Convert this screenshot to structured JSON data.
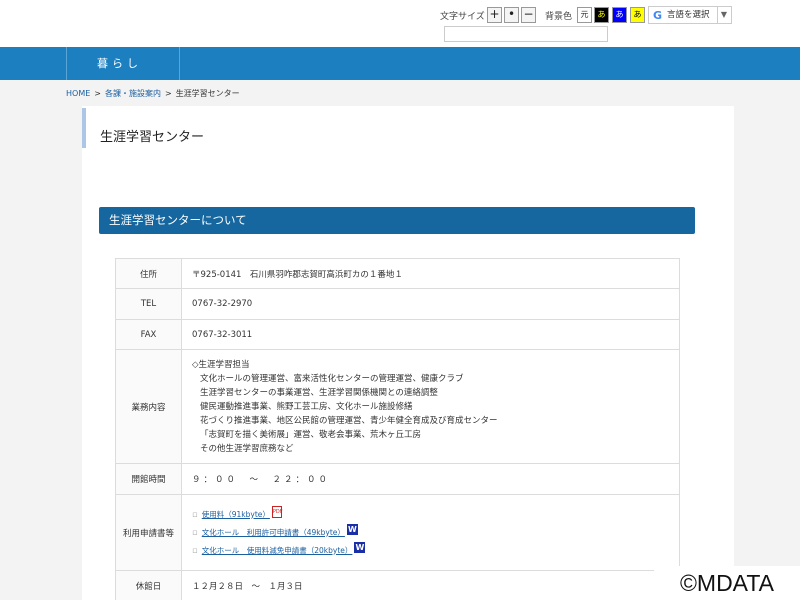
{
  "toolbar": {
    "font_size_label": "文字サイズ",
    "font_size_buttons": [
      "+",
      "•",
      "−"
    ],
    "bg_color_label": "背景色",
    "bg_swatches": [
      {
        "text": "元",
        "bg": "#ffffff",
        "fg": "#333333"
      },
      {
        "text": "あ",
        "bg": "#000000",
        "fg": "#ffff00"
      },
      {
        "text": "あ",
        "bg": "#0000ff",
        "fg": "#ffffff"
      },
      {
        "text": "あ",
        "bg": "#ffff00",
        "fg": "#000000"
      }
    ],
    "language_g": "G",
    "language_label": "言語を選択",
    "language_arrow": "▼",
    "search_value": ""
  },
  "nav": {
    "tab_label": "暮らし"
  },
  "breadcrumb": {
    "items": [
      "HOME",
      "各課・施設案内",
      "生涯学習センター"
    ],
    "separator": ">"
  },
  "page": {
    "title": "生涯学習センター",
    "section_title": "生涯学習センターについて"
  },
  "info": {
    "address_label": "住所",
    "address_value": "〒925-0141　石川県羽咋郡志賀町高浜町カの１番地１",
    "tel_label": "TEL",
    "tel_value": "0767-32-2970",
    "fax_label": "FAX",
    "fax_value": "0767-32-3011",
    "duties_label": "業務内容",
    "duties_lines": [
      "◇生涯学習担当",
      "文化ホールの管理運営、富来活性化センターの管理運営、健康クラブ",
      "生涯学習センターの事業運営、生涯学習関係機関との連絡調整",
      "健民運動推進事業、熊野工芸工房、文化ホール施設修繕",
      "花づくり推進事業、地区公民館の管理運営、青少年健全育成及び育成センター",
      "「志賀町を描く美術展」運営、敬老会事業、荒木ヶ丘工房",
      "その他生涯学習庶務など"
    ],
    "hours_label": "開館時間",
    "hours_value": "９：００　～　２２：００",
    "docs_label": "利用申請書等",
    "docs": [
      {
        "text": "使用料（91kbyte）",
        "icon": "pdf"
      },
      {
        "text": "文化ホール　利用許可申請書（49kbyte）",
        "icon": "word"
      },
      {
        "text": "文化ホール　使用料減免申請書（20kbyte）",
        "icon": "word"
      }
    ],
    "pdf_icon_text": "PDF",
    "word_icon_text": "W",
    "closed_label": "休館日",
    "closed_value": "１２月２８日　～　１月３日"
  },
  "watermark": "©MDATA"
}
